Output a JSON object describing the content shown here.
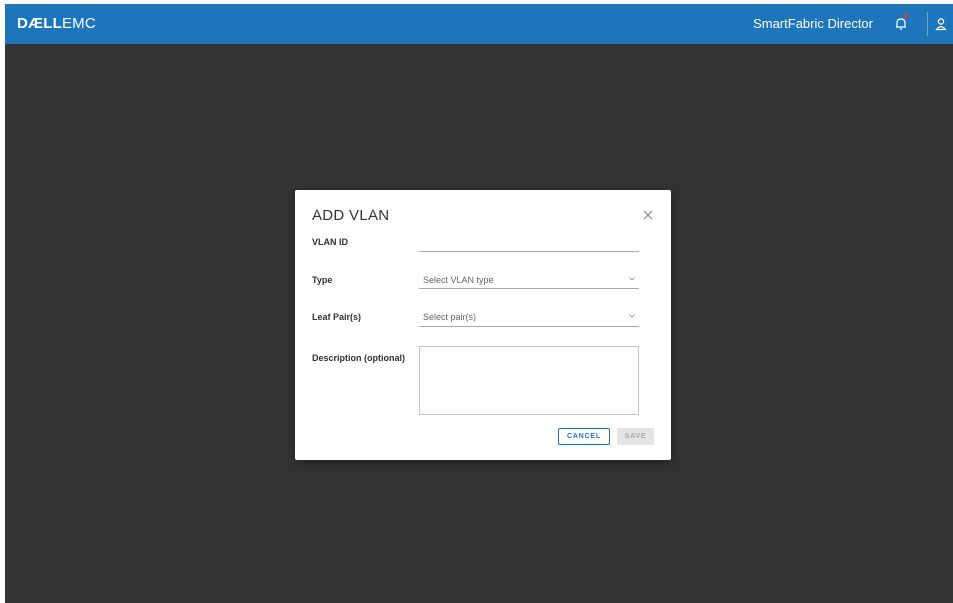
{
  "header": {
    "logo_brand": "DÆLL",
    "logo_suffix": "EMC",
    "product_name": "SmartFabric Director",
    "icons": [
      "bell-icon",
      "user-icon"
    ],
    "notification_dot": true
  },
  "dialog": {
    "title": "ADD VLAN",
    "close_icon": "close-icon",
    "fields": {
      "vlan_id": {
        "label": "VLAN ID",
        "value": ""
      },
      "type": {
        "label": "Type",
        "placeholder": "Select VLAN type"
      },
      "leaf_pairs": {
        "label": "Leaf Pair(s)",
        "placeholder": "Select pair(s)"
      },
      "description": {
        "label": "Description (optional)",
        "value": ""
      }
    },
    "buttons": {
      "cancel": "CANCEL",
      "save": "SAVE"
    }
  },
  "colors": {
    "accent": "#1e76ba",
    "background": "#333333",
    "dialog": "#ffffff",
    "save_disabled_bg": "#e4e4e4"
  }
}
